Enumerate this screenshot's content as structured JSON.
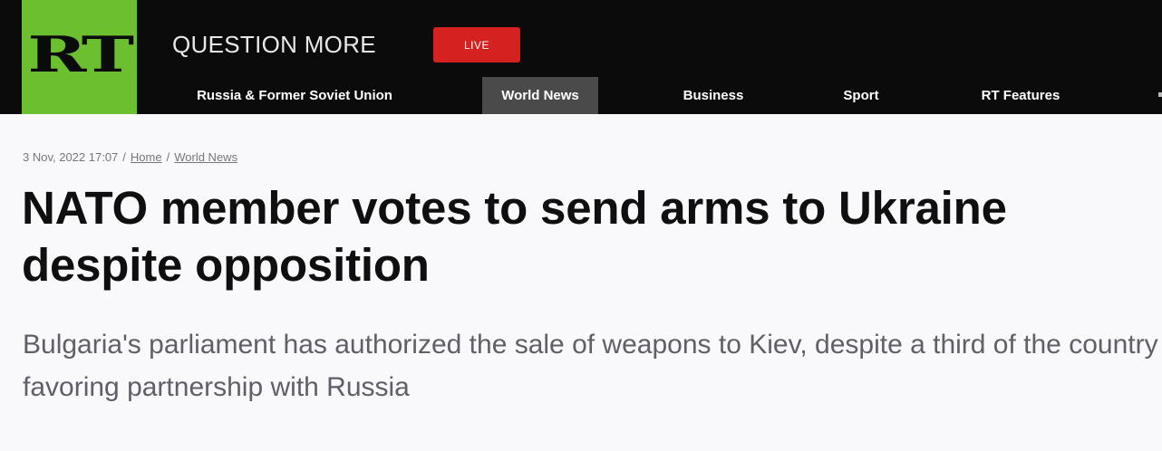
{
  "header": {
    "logo": "RT",
    "tagline": "QUESTION MORE",
    "live_label": "LIVE",
    "nav": [
      {
        "label": "Russia & Former Soviet Union",
        "active": false
      },
      {
        "label": "World News",
        "active": true
      },
      {
        "label": "Business",
        "active": false
      },
      {
        "label": "Sport",
        "active": false
      },
      {
        "label": "RT Features",
        "active": false
      }
    ]
  },
  "article": {
    "date": "3 Nov, 2022 17:07",
    "breadcrumb": [
      "Home",
      "World News"
    ],
    "headline": "NATO member votes to send arms to Ukraine despite opposition",
    "summary": "Bulgaria's parliament has authorized the sale of weapons to Kiev, despite a third of the country favoring partnership with Russia"
  },
  "colors": {
    "header_bg": "#0b0b0b",
    "logo_green": "#6cc02f",
    "live_red": "#d62121",
    "active_nav_bg": "#4a4a4a"
  }
}
